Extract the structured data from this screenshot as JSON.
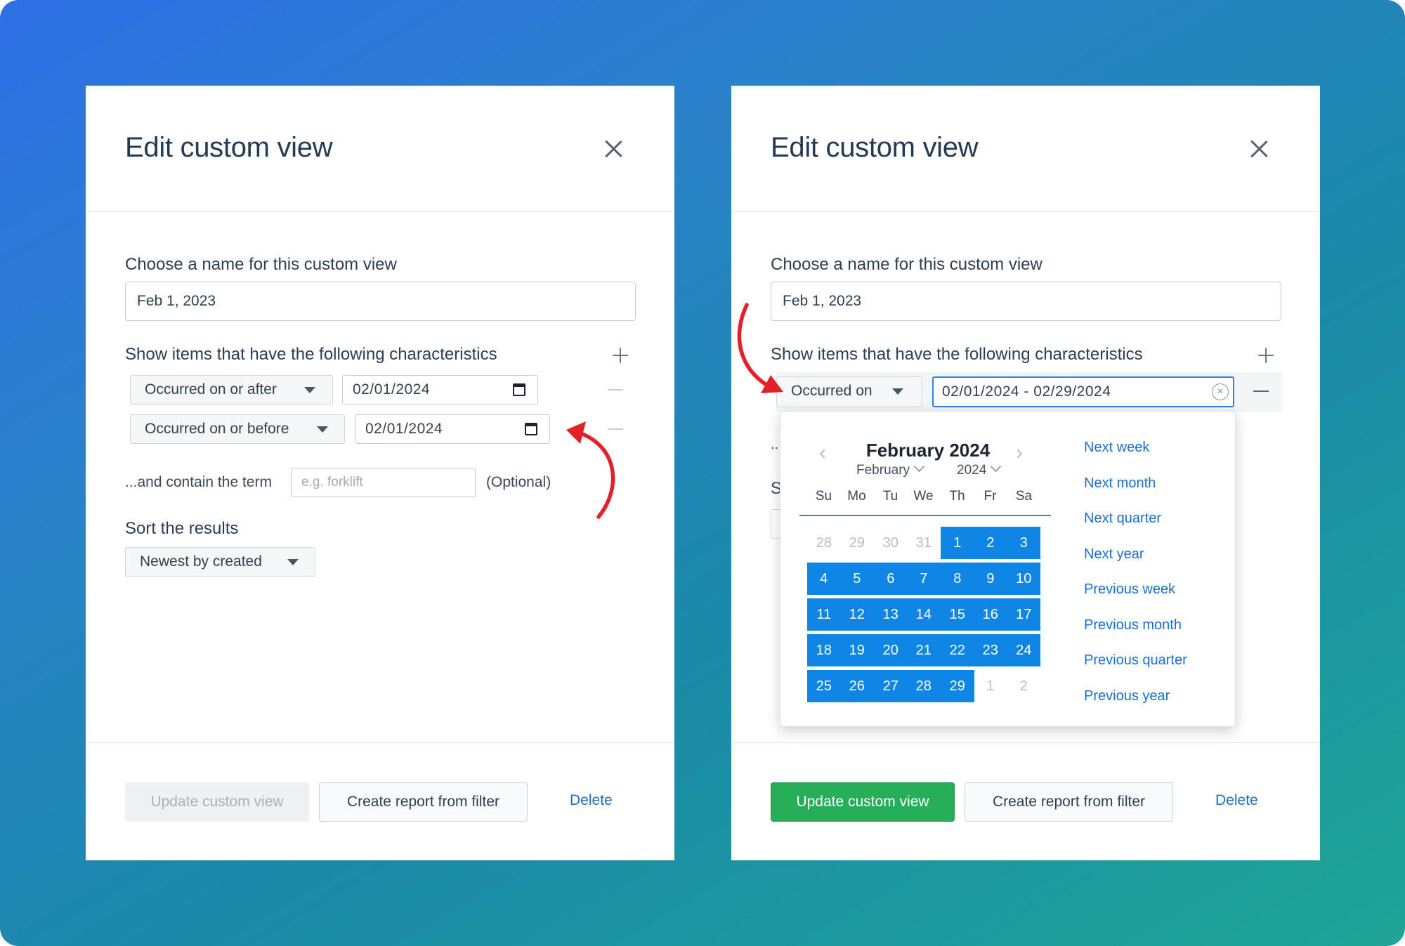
{
  "colors": {
    "background_start": "#2f6fe6",
    "background_end": "#1fa596",
    "accent_link": "#1a6fd0",
    "primary_button": "#27ae58",
    "selected_day": "#0f86e4",
    "annotation_arrow": "#e3212b"
  },
  "left": {
    "title": "Edit custom view",
    "name_label": "Choose a name for this custom view",
    "name_value": "Feb 1, 2023",
    "characteristics_label": "Show items that have the following characteristics",
    "filters": [
      {
        "operator": "Occurred on or after",
        "date": "02/01/2024"
      },
      {
        "operator": "Occurred on or before",
        "date": "02/01/2024"
      }
    ],
    "term_label": "...and contain the term",
    "term_placeholder": "e.g. forklift",
    "term_optional": "(Optional)",
    "sort_label": "Sort the results",
    "sort_value": "Newest by created",
    "buttons": {
      "update": "Update custom view",
      "create_report": "Create report from filter",
      "delete": "Delete"
    }
  },
  "right": {
    "title": "Edit custom view",
    "name_label": "Choose a name for this custom view",
    "name_value": "Feb 1, 2023",
    "characteristics_label": "Show items that have the following characteristics",
    "filter": {
      "operator": "Occurred on",
      "range": "02/01/2024 - 02/29/2024"
    },
    "hidden_text_1": "..",
    "hidden_text_2": "S",
    "calendar": {
      "title": "February 2024",
      "month_select": "February",
      "year_select": "2024",
      "weekdays": [
        "Su",
        "Mo",
        "Tu",
        "We",
        "Th",
        "Fr",
        "Sa"
      ],
      "weeks": [
        [
          "28",
          "29",
          "30",
          "31",
          "1",
          "2",
          "3"
        ],
        [
          "4",
          "5",
          "6",
          "7",
          "8",
          "9",
          "10"
        ],
        [
          "11",
          "12",
          "13",
          "14",
          "15",
          "16",
          "17"
        ],
        [
          "18",
          "19",
          "20",
          "21",
          "22",
          "23",
          "24"
        ],
        [
          "25",
          "26",
          "27",
          "28",
          "29",
          "1",
          "2"
        ]
      ],
      "presets": [
        "Next week",
        "Next month",
        "Next quarter",
        "Next year",
        "Previous week",
        "Previous month",
        "Previous quarter",
        "Previous year"
      ]
    },
    "buttons": {
      "update": "Update custom view",
      "create_report": "Create report from filter",
      "delete": "Delete"
    }
  }
}
